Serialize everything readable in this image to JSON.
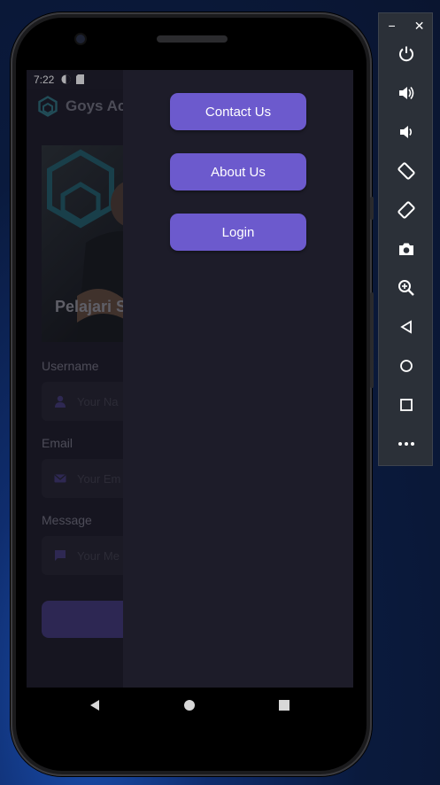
{
  "status_bar": {
    "time": "7:22"
  },
  "app": {
    "title": "Goys Aca",
    "hero_text": "Pelajari S",
    "fields": [
      {
        "label": "Username",
        "placeholder": "Your Na"
      },
      {
        "label": "Email",
        "placeholder": "Your Em"
      },
      {
        "label": "Message",
        "placeholder": "Your Me"
      }
    ]
  },
  "drawer": {
    "items": [
      {
        "label": "Contact Us"
      },
      {
        "label": "About Us"
      },
      {
        "label": "Login"
      }
    ]
  },
  "colors": {
    "accent": "#6c5acd",
    "drawer_bg": "#1d1c29",
    "screen_bg": "#1b1a26"
  },
  "emulator_toolbar": {
    "minimize_label": "−",
    "close_label": "✕",
    "buttons": [
      "power-icon",
      "volume-up-icon",
      "volume-down-icon",
      "rotate-left-icon",
      "rotate-right-icon",
      "camera-icon",
      "zoom-icon",
      "back-icon",
      "home-icon",
      "overview-icon",
      "more-icon"
    ]
  }
}
